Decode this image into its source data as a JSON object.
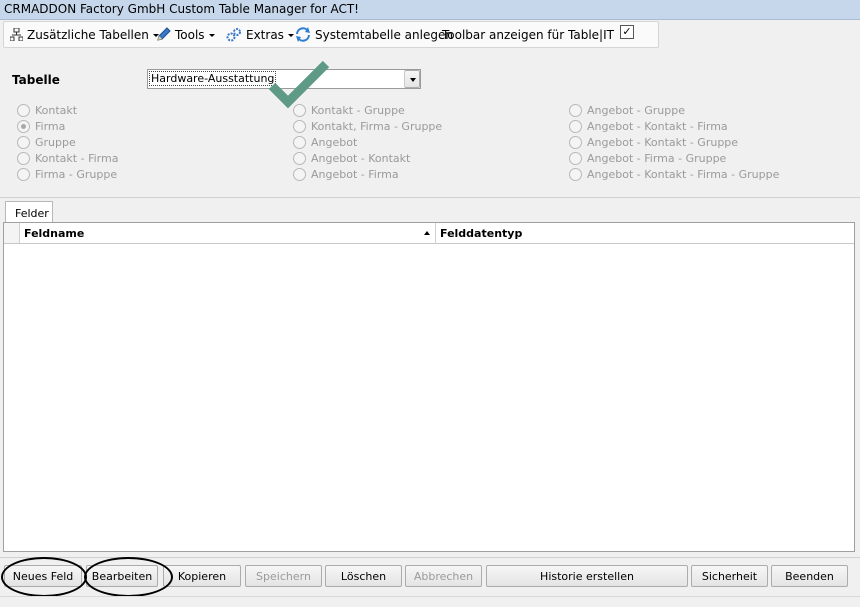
{
  "window": {
    "title": "CRMADDON Factory GmbH Custom Table Manager for ACT!"
  },
  "toolbar": {
    "extra_tables": "Zusätzliche Tabellen",
    "tools": "Tools",
    "extras": "Extras",
    "system_table": "Systemtabelle anlegen",
    "show_toolbar": "Toolbar anzeigen für Table|IT",
    "show_toolbar_checked": "✓"
  },
  "table_selector": {
    "label": "Tabelle",
    "value": "Hardware-Ausstattung"
  },
  "radios": {
    "col1": [
      "Kontakt",
      "Firma",
      "Gruppe",
      "Kontakt - Firma",
      "Firma - Gruppe"
    ],
    "col2": [
      "Kontakt - Gruppe",
      "Kontakt, Firma - Gruppe",
      "Angebot",
      "Angebot - Kontakt",
      "Angebot - Firma"
    ],
    "col3": [
      "Angebot - Gruppe",
      "Angebot - Kontakt - Firma",
      "Angebot - Kontakt - Gruppe",
      "Angebot - Firma - Gruppe",
      "Angebot - Kontakt - Firma - Gruppe"
    ],
    "selected": "Firma"
  },
  "tabs": {
    "fields": "Felder"
  },
  "grid": {
    "col_fieldname": "Feldname",
    "col_datatype": "Felddatentyp"
  },
  "buttons": {
    "new_field": "Neues Feld",
    "edit": "Bearbeiten",
    "copy": "Kopieren",
    "save": "Speichern",
    "delete": "Löschen",
    "cancel": "Abbrechen",
    "history": "Historie erstellen",
    "backup": "Sicherheit",
    "exit": "Beenden"
  },
  "colors": {
    "check_overlay": "#5f9a86",
    "annotation_ring": "#000000"
  }
}
